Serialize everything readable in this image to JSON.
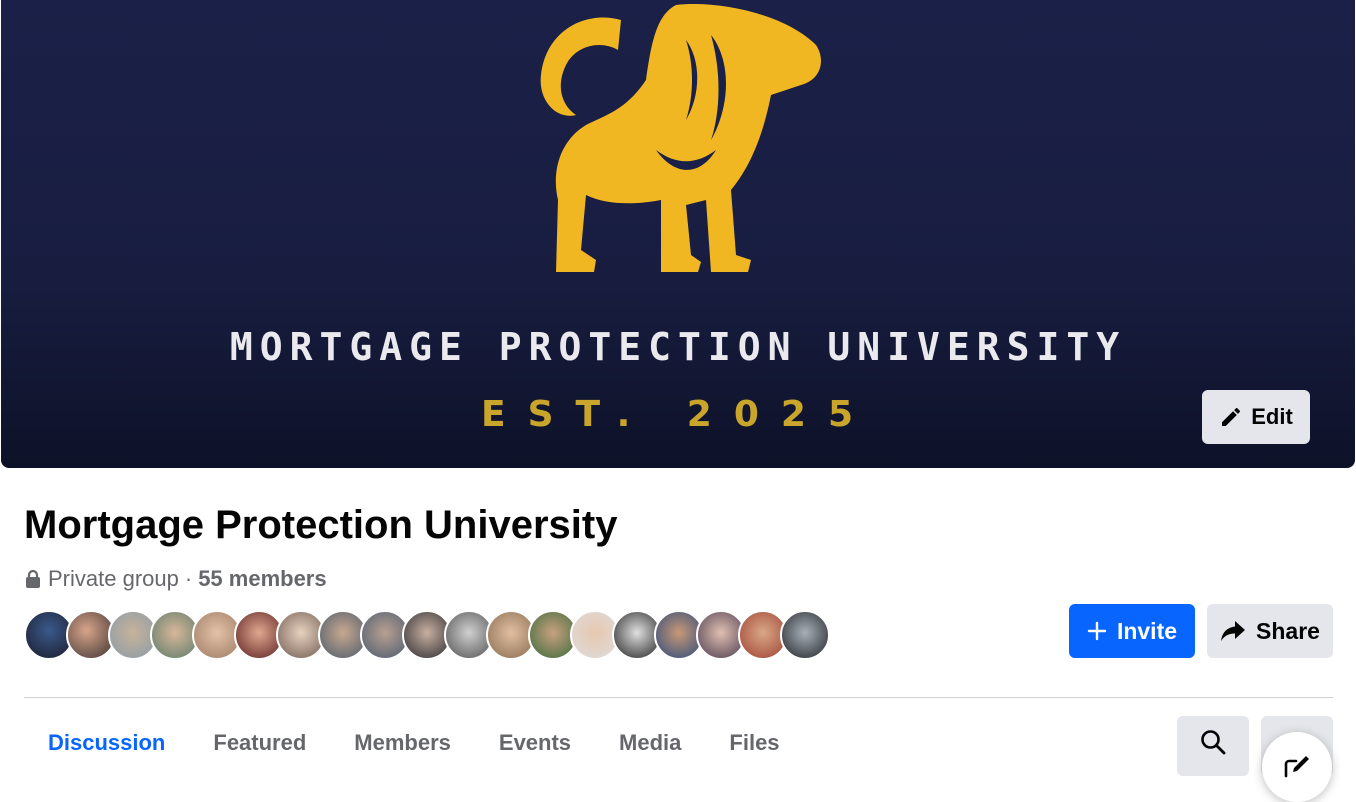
{
  "cover": {
    "title": "MORTGAGE PROTECTION UNIVERSITY",
    "established": "EST. 2025",
    "edit_label": "Edit",
    "colors": {
      "background": "#1b2048",
      "lion": "#f0b722",
      "est_text": "#c9a52b"
    }
  },
  "group": {
    "name": "Mortgage Protection University",
    "privacy": "Private group",
    "separator": "·",
    "members": "55 members",
    "avatar_count": 19
  },
  "actions": {
    "invite_label": "Invite",
    "share_label": "Share"
  },
  "tabs": [
    {
      "label": "Discussion",
      "active": true
    },
    {
      "label": "Featured",
      "active": false
    },
    {
      "label": "Members",
      "active": false
    },
    {
      "label": "Events",
      "active": false
    },
    {
      "label": "Media",
      "active": false
    },
    {
      "label": "Files",
      "active": false
    }
  ],
  "icons": [
    "pencil-icon",
    "lock-icon",
    "plus-icon",
    "share-arrow-icon",
    "search-icon",
    "compose-icon"
  ],
  "colors": {
    "primary": "#0866ff",
    "secondary_button": "#e4e6eb",
    "text": "#050505",
    "muted": "#65676b"
  }
}
